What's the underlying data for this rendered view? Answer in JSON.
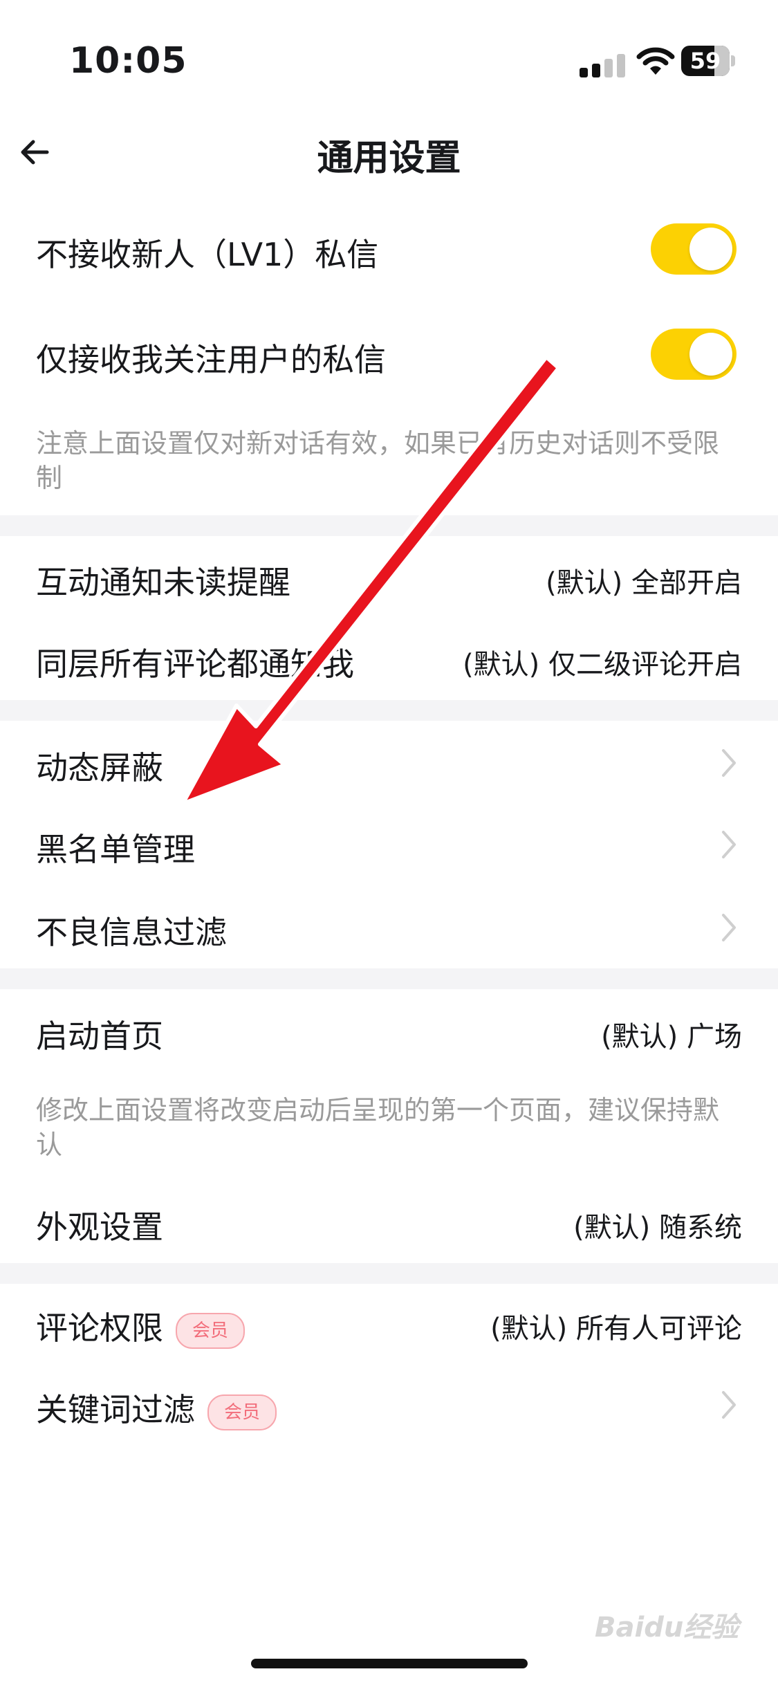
{
  "status_bar": {
    "time": "10:05",
    "battery": "59"
  },
  "nav": {
    "title": "通用设置"
  },
  "messages": {
    "toggle1_label": "不接收新人（LV1）私信",
    "toggle1_on": true,
    "toggle2_label": "仅接收我关注用户的私信",
    "toggle2_on": true,
    "note": "注意上面设置仅对新对话有效，如果已有历史对话则不受限制"
  },
  "notify": {
    "item1_label": "互动通知未读提醒",
    "item1_value": "(默认) 全部开启",
    "item2_label": "同层所有评论都通知我",
    "item2_value": "(默认) 仅二级评论开启"
  },
  "filters": {
    "item1_label": "动态屏蔽",
    "item2_label": "黑名单管理",
    "item3_label": "不良信息过滤"
  },
  "startup": {
    "item_label": "启动首页",
    "item_value": "(默认) 广场",
    "note": "修改上面设置将改变启动后呈现的第一个页面，建议保持默认",
    "appearance_label": "外观设置",
    "appearance_value": "(默认) 随系统"
  },
  "member": {
    "comment_label": "评论权限",
    "comment_badge": "会员",
    "comment_value": "(默认) 所有人可评论",
    "keyword_label": "关键词过滤",
    "keyword_badge": "会员"
  },
  "watermark": "Baidu经验",
  "colors": {
    "toggle": "#fcd103",
    "arrow": "#e8141e",
    "badge": "#f26d7a"
  }
}
